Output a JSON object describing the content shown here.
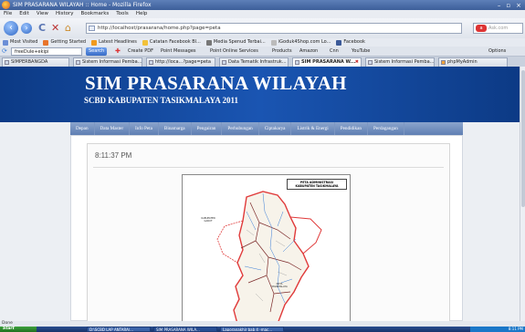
{
  "window": {
    "title": "SIM PRASARANA WILAYAH :: Home - Mozilla Firefox",
    "controls": [
      "–",
      "▫",
      "×"
    ]
  },
  "menu": [
    "File",
    "Edit",
    "View",
    "History",
    "Bookmarks",
    "Tools",
    "Help"
  ],
  "nav": {
    "url": "http://localhost/prasarana/home.php?page=peta",
    "search_engine": "Ask.com",
    "search_placeholder": "Ask.com"
  },
  "bookmarks": [
    "Most Visited",
    "Getting Started",
    "Latest Headlines",
    "Catatan Facebook Bl...",
    "Media Spenud Terbai...",
    "iGoduk4Shop.com Lo...",
    "Facebook"
  ],
  "toolbar": {
    "combo_value": "freeDule+ekipi",
    "search_label": "Search",
    "items": [
      "Create PDF",
      "Point Messages",
      "Point Online Services",
      "Products",
      "Amazon",
      "Cnn",
      "YouTube"
    ],
    "options_label": "Options"
  },
  "tabs": [
    {
      "label": "SIMPERBANGDA",
      "active": false
    },
    {
      "label": "Sistem Informasi Pemba...",
      "active": false
    },
    {
      "label": "http://loca...?page=peta",
      "active": false
    },
    {
      "label": "Data Tematik Infrastruk...",
      "active": false
    },
    {
      "label": "SIM PRASARANA W...",
      "active": true
    },
    {
      "label": "Sistem Informasi Pemba...",
      "active": false
    },
    {
      "label": "phpMyAdmin",
      "active": false
    }
  ],
  "site": {
    "title": "SIM PRASARANA WILAYAH",
    "subtitle": "SCBD KABUPATEN TASIKMALAYA 2011",
    "nav": [
      "Depan",
      "Data Master",
      "Info Peta",
      "Binamarga",
      "Pengairan",
      "Perhubungan",
      "Ciptakarya",
      "Listrik & Energi",
      "Pendidikan",
      "Perdagangan"
    ],
    "clock": "8:11:37 PM"
  },
  "map": {
    "title_line1": "PETA ADMINISTRASI",
    "title_line2": "KABUPATEN TASIKMALAYA",
    "label_west": "KABUPATEN GARUT",
    "label_center": "KOTA TASIKMALAYA",
    "colors": {
      "border": "#e03a3a",
      "roads": "#7c2a2a",
      "rivers": "#3a7dd8",
      "land": "#f7f3ea"
    }
  },
  "status": "Done",
  "taskbar": {
    "start": "Start",
    "items": [
      "D:\\SCBD LAP ANTARA\\...",
      "SIM PRASARANA WILA...",
      "Laporanakhir bab 4 -mac..."
    ],
    "clock": "8:11 PM"
  }
}
